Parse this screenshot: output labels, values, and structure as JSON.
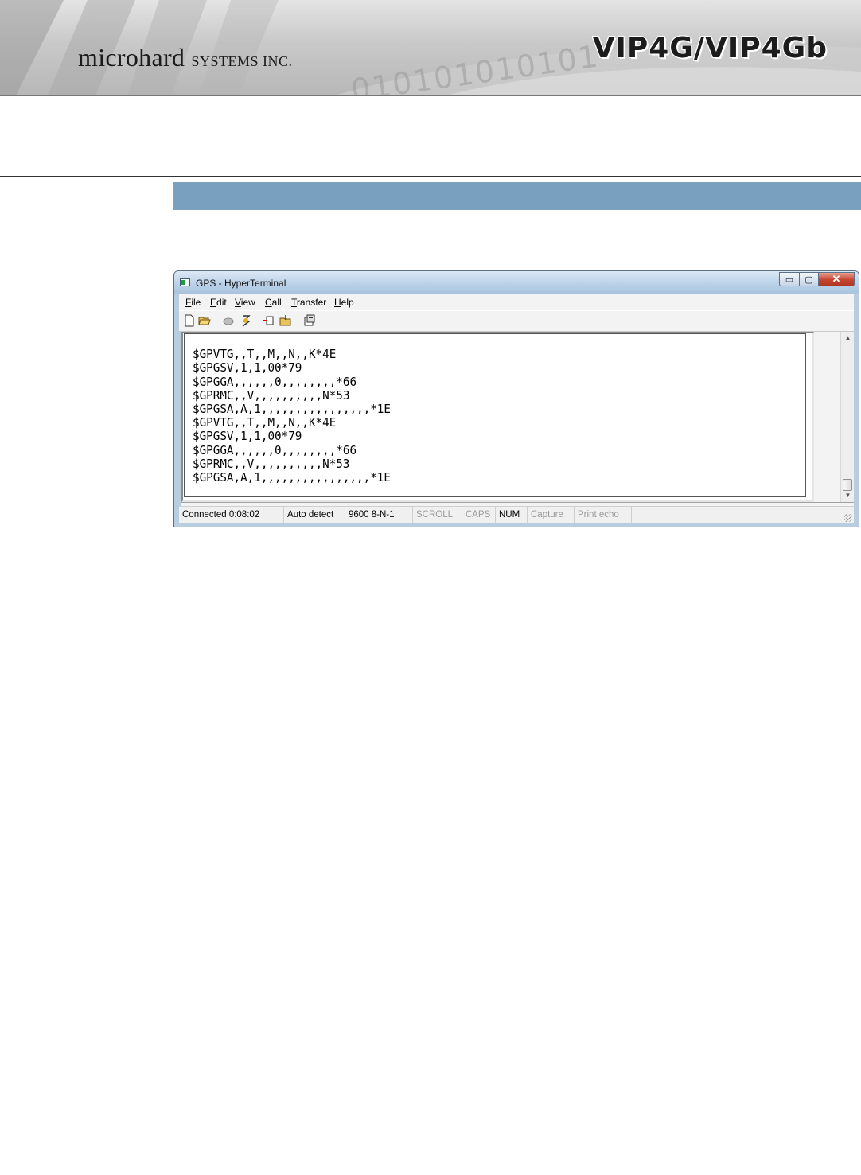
{
  "header": {
    "brand": "microhard",
    "brand_suffix": "SYSTEMS INC.",
    "product": "VIP4G/VIP4Gb",
    "binary_strip": "010101010101"
  },
  "window": {
    "title": "GPS - HyperTerminal",
    "controls": {
      "minimize": "▭",
      "maximize": "▢",
      "close": "✕"
    },
    "menu": [
      {
        "u": "F",
        "rest": "ile"
      },
      {
        "u": "E",
        "rest": "dit"
      },
      {
        "u": "V",
        "rest": "iew"
      },
      {
        "u": "C",
        "rest": "all"
      },
      {
        "u": "T",
        "rest": "ransfer"
      },
      {
        "u": "H",
        "rest": "elp"
      }
    ],
    "toolbar_icons": [
      "new-icon",
      "open-icon",
      "disconnect-icon",
      "connect-icon",
      "send-icon",
      "receive-icon",
      "properties-icon"
    ],
    "terminal_lines": [
      "$GPVTG,,T,,M,,N,,K*4E",
      "$GPGSV,1,1,00*79",
      "$GPGGA,,,,,,0,,,,,,,,*66",
      "$GPRMC,,V,,,,,,,,,,N*53",
      "$GPGSA,A,1,,,,,,,,,,,,,,,,*1E",
      "$GPVTG,,T,,M,,N,,K*4E",
      "$GPGSV,1,1,00*79",
      "$GPGGA,,,,,,0,,,,,,,,*66",
      "$GPRMC,,V,,,,,,,,,,N*53",
      "$GPGSA,A,1,,,,,,,,,,,,,,,,*1E"
    ],
    "status": {
      "connected": "Connected 0:08:02",
      "detect": "Auto detect",
      "port": "9600 8-N-1",
      "scroll": "SCROLL",
      "caps": "CAPS",
      "num": "NUM",
      "capture": "Capture",
      "print_echo": "Print echo"
    }
  }
}
